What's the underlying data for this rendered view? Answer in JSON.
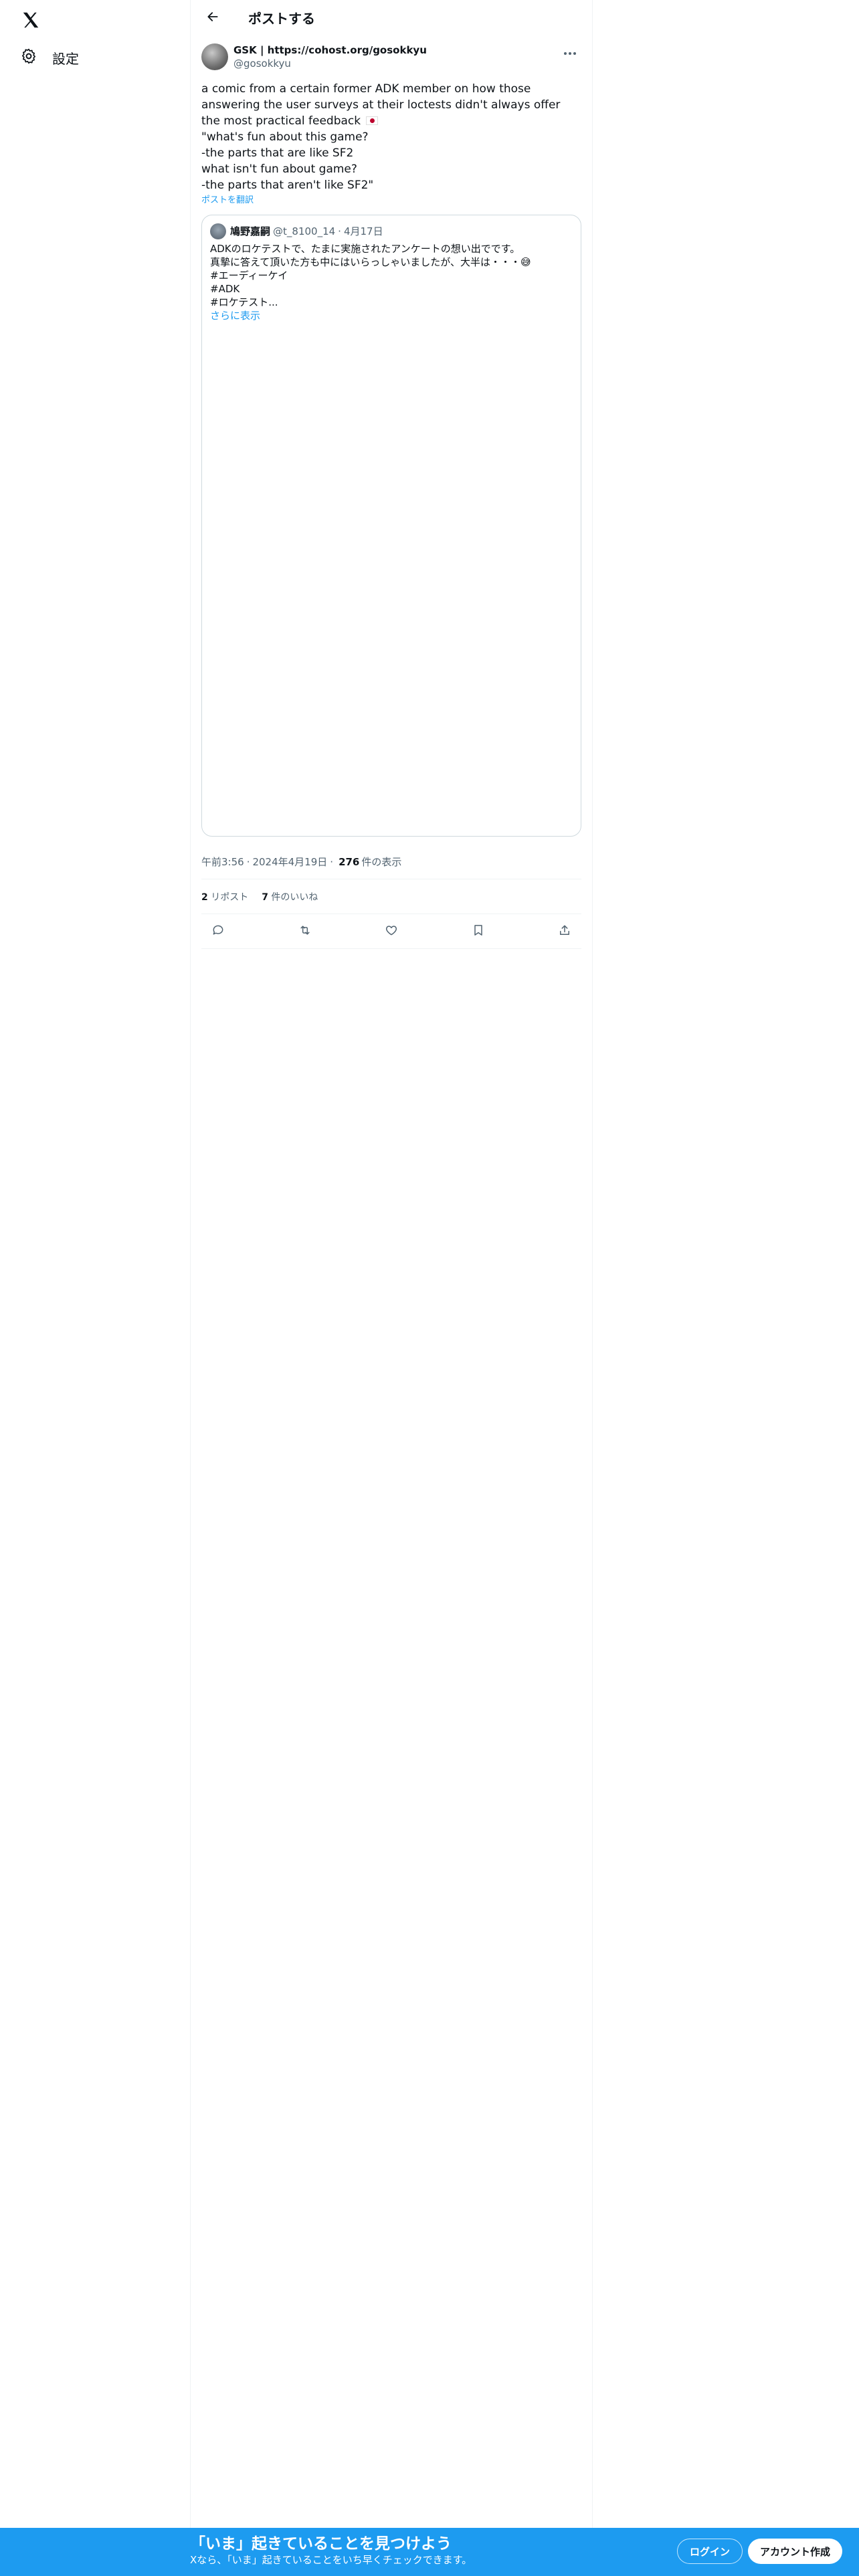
{
  "nav": {
    "logo_icon": "x-logo-icon",
    "settings_label": "設定",
    "settings_icon": "gear-icon"
  },
  "header": {
    "back_icon": "arrow-left-icon",
    "title": "ポストする"
  },
  "post": {
    "display_name": "GSK | https://cohost.org/gosokkyu",
    "handle": "@gosokkyu",
    "text_line1": "a comic from a certain former ADK member on how those answering the user surveys at their loctests didn't always offer the most practical feedback",
    "text_rest": "\n\"what's fun about this game?\n-the parts that are like SF2\nwhat isn't fun about game?\n-the parts that aren't like SF2\"",
    "translate_label": "ポストを翻訳",
    "quote": {
      "display_name": "鳩野嘉嗣",
      "handle": "@t_8100_14",
      "separator": "·",
      "date": "4月17日",
      "text": "ADKのロケテストで、たまに実施されたアンケートの想い出でです。\n真摯に答えて頂いた方も中にはいらっしゃいましたが、大半は・・・😅\n#エーディーケイ\n#ADK\n#ロケテスト...",
      "show_more": "さらに表示"
    },
    "time": "午前3:56",
    "dot": "·",
    "date": "2024年4月19日",
    "views_count": "276",
    "views_label": "件の表示",
    "reposts_count": "2",
    "reposts_label": "リポスト",
    "likes_count": "7",
    "likes_label": "件のいいね"
  },
  "banner": {
    "title": "「いま」起きていることを見つけよう",
    "subtitle": "Xなら、「いま」起きていることをいち早くチェックできます。",
    "login_label": "ログイン",
    "signup_label": "アカウント作成"
  },
  "colors": {
    "accent": "#1d9bf0",
    "text": "#0f1419",
    "secondary": "#536471",
    "border": "#eff3f4"
  }
}
